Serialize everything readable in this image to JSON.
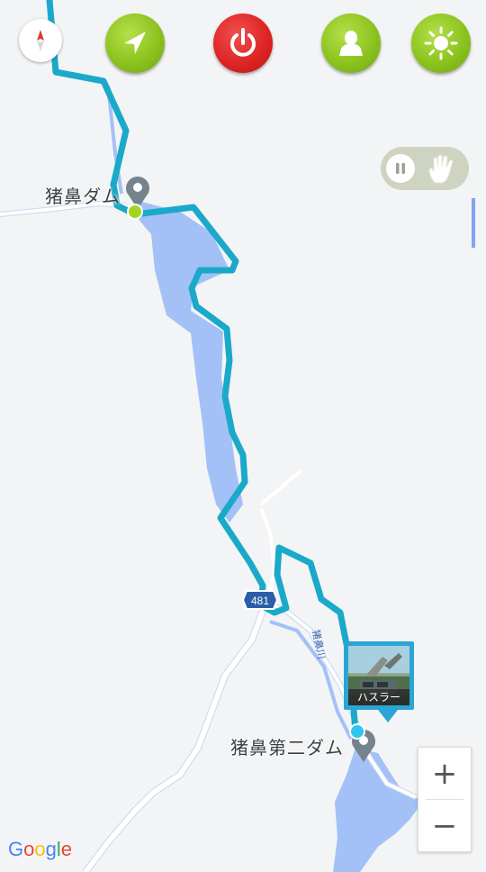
{
  "toolbar": {
    "compass_icon": "compass-icon",
    "navigate_icon": "navigation-arrow-icon",
    "power_icon": "power-icon",
    "profile_icon": "person-icon",
    "brightness_icon": "sun-icon"
  },
  "toggle": {
    "state": "paused",
    "left_icon": "pause-icon",
    "right_icon": "hand-icon"
  },
  "map": {
    "places": [
      {
        "name": "猪鼻ダム"
      },
      {
        "name": "猪鼻第二ダム"
      }
    ],
    "road_shield": "481",
    "river_label": "猪鼻川"
  },
  "photo_marker": {
    "caption": "ハスラー"
  },
  "zoom": {
    "in_label": "+",
    "out_label": "−"
  },
  "attribution": {
    "google": [
      "G",
      "o",
      "o",
      "g",
      "l",
      "e"
    ]
  },
  "colors": {
    "track": "#1ba9c9",
    "water": "#a3c1f7",
    "road": "#ffffff",
    "green_button": "#8dc31f",
    "red_button": "#dd2222",
    "photo_frame": "#2aa5d5"
  }
}
